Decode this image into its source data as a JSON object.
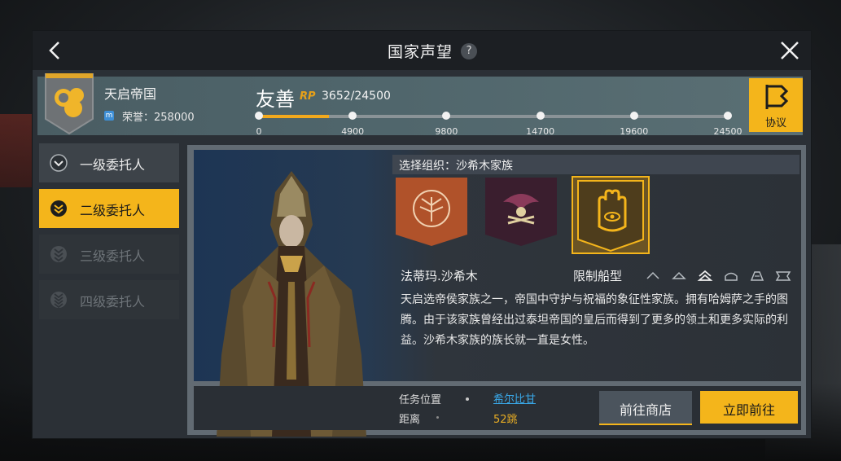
{
  "window": {
    "title": "国家声望",
    "help": "?"
  },
  "nation": {
    "name": "天启帝国",
    "honor_label": "荣誉：258000",
    "honor_icon": "m"
  },
  "reputation": {
    "level": "友善",
    "rp_tag": "RP",
    "rp_value": "3652/24500",
    "progress": 0.149,
    "ticks": [
      "0",
      "4900",
      "9800",
      "14700",
      "19600",
      "24500"
    ],
    "accent": "#f4b51b"
  },
  "protocol_button": {
    "label": "协议"
  },
  "tabs": [
    {
      "label": "一级委托人",
      "state": "normal"
    },
    {
      "label": "二级委托人",
      "state": "active"
    },
    {
      "label": "三级委托人",
      "state": "locked"
    },
    {
      "label": "四级委托人",
      "state": "locked"
    }
  ],
  "organization": {
    "header": "选择组织：沙希木家族",
    "cards": [
      "tree-emblem-icon",
      "bird-emblem-icon",
      "hamsa-emblem-icon"
    ],
    "selected": 2
  },
  "character": {
    "name": "法蒂玛.沙希木",
    "ship_type_label": "限制船型",
    "ship_icons": [
      "frigate-icon",
      "destroyer-icon",
      "cruiser-icon",
      "battlecruiser-icon",
      "battleship-icon",
      "carrier-icon"
    ],
    "description": "天启选帝侯家族之一，帝国中守护与祝福的象征性家族。拥有哈姆萨之手的图腾。由于该家族曾经出过泰坦帝国的皇后而得到了更多的领土和更多实际的利益。沙希木家族的族长就一直是女性。"
  },
  "mission": {
    "location_label": "任务位置",
    "location_value": "希尔比甘",
    "distance_label": "距离",
    "distance_value": "52跳"
  },
  "buttons": {
    "shop": "前往商店",
    "go": "立即前往"
  }
}
